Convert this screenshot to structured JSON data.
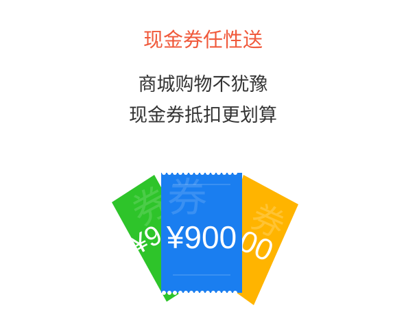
{
  "promo": {
    "headline": "现金券任性送",
    "line1": "商城购物不犹豫",
    "line2": "现金券抵扣更划算"
  },
  "tickets": {
    "front_amount": "¥900",
    "left_amount": "¥9",
    "right_amount": "00",
    "watermark": "券",
    "colors": {
      "left": "#2ec42a",
      "center": "#1a7ef0",
      "right": "#ffb400",
      "headline": "#f05a3c"
    }
  }
}
